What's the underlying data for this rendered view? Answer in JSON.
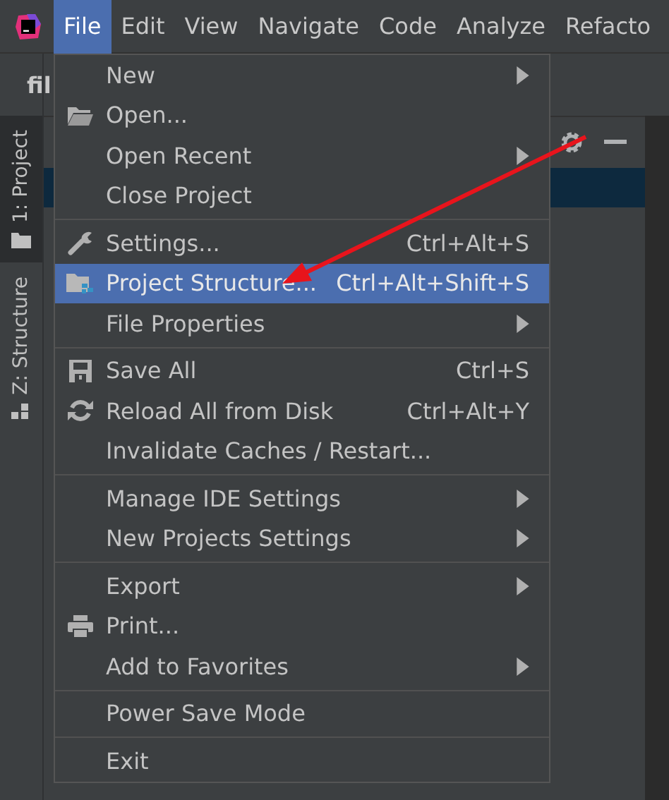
{
  "menubar": [
    {
      "label": "File",
      "selected": true
    },
    {
      "label": "Edit",
      "selected": false
    },
    {
      "label": "View",
      "selected": false
    },
    {
      "label": "Navigate",
      "selected": false
    },
    {
      "label": "Code",
      "selected": false
    },
    {
      "label": "Analyze",
      "selected": false
    },
    {
      "label": "Refacto",
      "selected": false
    }
  ],
  "tool_windows": [
    {
      "label": "1: Project",
      "selected": true
    },
    {
      "label": "Z: Structure",
      "selected": false
    }
  ],
  "project_header": "fil",
  "menu": [
    [
      {
        "label": "New",
        "submenu": true,
        "selected": false
      },
      {
        "label": "Open...",
        "kind": "folder",
        "submenu": false,
        "selected": false
      },
      {
        "label": "Open Recent",
        "submenu": true,
        "selected": false
      },
      {
        "label": "Close Project",
        "submenu": false,
        "selected": false
      }
    ],
    [
      {
        "label": "Settings...",
        "kind": "wrench",
        "shortcut": "Ctrl+Alt+S",
        "submenu": false,
        "selected": false
      },
      {
        "label": "Project Structure...",
        "kind": "project",
        "shortcut": "Ctrl+Alt+Shift+S",
        "submenu": false,
        "selected": true
      },
      {
        "label": "File Properties",
        "submenu": true,
        "selected": false
      }
    ],
    [
      {
        "label": "Save All",
        "kind": "save",
        "shortcut": "Ctrl+S",
        "submenu": false,
        "selected": false
      },
      {
        "label": "Reload All from Disk",
        "kind": "reload",
        "shortcut": "Ctrl+Alt+Y",
        "submenu": false,
        "selected": false
      },
      {
        "label": "Invalidate Caches / Restart...",
        "submenu": false,
        "selected": false
      }
    ],
    [
      {
        "label": "Manage IDE Settings",
        "submenu": true,
        "selected": false
      },
      {
        "label": "New Projects Settings",
        "submenu": true,
        "selected": false
      }
    ],
    [
      {
        "label": "Export",
        "submenu": true,
        "selected": false
      },
      {
        "label": "Print...",
        "kind": "print",
        "submenu": false,
        "selected": false
      },
      {
        "label": "Add to Favorites",
        "submenu": true,
        "selected": false
      }
    ],
    [
      {
        "label": "Power Save Mode",
        "submenu": false,
        "selected": false
      }
    ],
    [
      {
        "label": "Exit",
        "submenu": false,
        "selected": false
      }
    ]
  ]
}
